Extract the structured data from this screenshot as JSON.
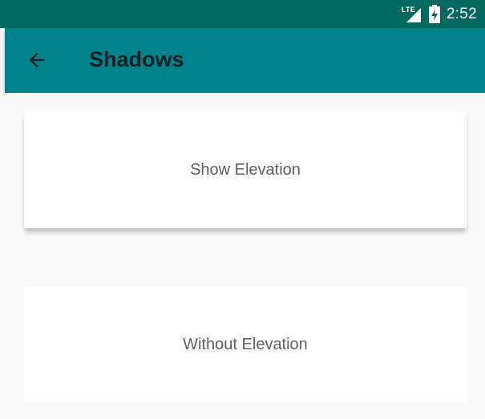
{
  "status_bar": {
    "network_label": "LTE",
    "time": "2:52",
    "icons": [
      "signal-icon",
      "battery-icon"
    ]
  },
  "app_bar": {
    "title": "Shadows",
    "back_icon": "arrow-back-icon"
  },
  "cards": [
    {
      "label": "Show Elevation"
    },
    {
      "label": "Without Elevation"
    }
  ],
  "colors": {
    "status_bar": "#00695f",
    "app_bar": "#00838a",
    "background": "#fafafa",
    "card": "#ffffff",
    "card_text": "#5f5f5f"
  }
}
